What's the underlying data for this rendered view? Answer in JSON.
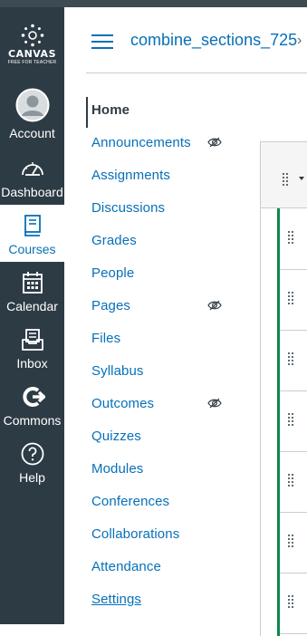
{
  "colors": {
    "nav_bg": "#2d3b45",
    "link": "#0770b8",
    "publish_green": "#0b874b",
    "divider": "#c7cdd1"
  },
  "logo": {
    "name": "CANVAS",
    "tagline": "FREE FOR TEACHER"
  },
  "global_nav": {
    "items": [
      {
        "label": "Account",
        "icon": "account-avatar-icon"
      },
      {
        "label": "Dashboard",
        "icon": "dashboard-gauge-icon"
      },
      {
        "label": "Courses",
        "icon": "courses-book-icon",
        "active": true
      },
      {
        "label": "Calendar",
        "icon": "calendar-icon"
      },
      {
        "label": "Inbox",
        "icon": "inbox-icon"
      },
      {
        "label": "Commons",
        "icon": "commons-icon"
      },
      {
        "label": "Help",
        "icon": "help-question-icon"
      }
    ]
  },
  "header": {
    "breadcrumb": "combine_sections_725",
    "separator": "›"
  },
  "course_nav": {
    "items": [
      {
        "label": "Home",
        "current": true
      },
      {
        "label": "Announcements",
        "hidden": true
      },
      {
        "label": "Assignments"
      },
      {
        "label": "Discussions"
      },
      {
        "label": "Grades"
      },
      {
        "label": "People"
      },
      {
        "label": "Pages",
        "hidden": true
      },
      {
        "label": "Files"
      },
      {
        "label": "Syllabus"
      },
      {
        "label": "Outcomes",
        "hidden": true
      },
      {
        "label": "Quizzes"
      },
      {
        "label": "Modules"
      },
      {
        "label": "Conferences"
      },
      {
        "label": "Collaborations"
      },
      {
        "label": "Attendance"
      },
      {
        "label": "Settings"
      }
    ]
  },
  "modules_panel": {
    "rows_visible": 7
  }
}
